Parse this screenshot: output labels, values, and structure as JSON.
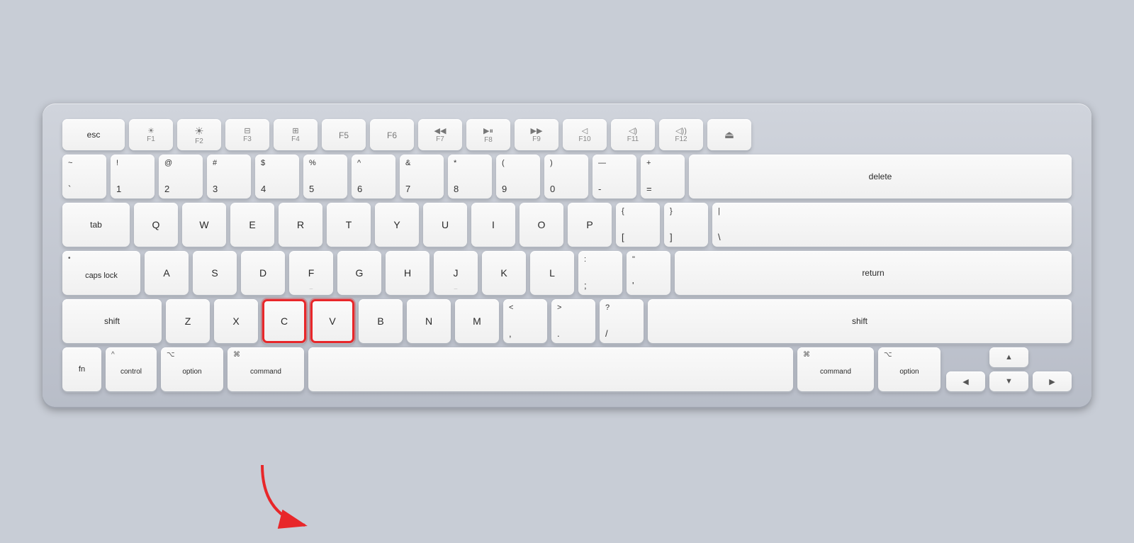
{
  "keyboard": {
    "background_color": "#c0c5d0",
    "rows": {
      "fn_row": {
        "keys": [
          {
            "id": "esc",
            "label": "esc",
            "type": "text"
          },
          {
            "id": "f1",
            "icon": "☀",
            "sub": "F1",
            "type": "icon-fn"
          },
          {
            "id": "f2",
            "icon": "☀",
            "sub": "F2",
            "type": "icon-fn"
          },
          {
            "id": "f3",
            "icon": "⊞",
            "sub": "F3",
            "type": "icon-fn"
          },
          {
            "id": "f4",
            "icon": "⊞⊞",
            "sub": "F4",
            "type": "icon-fn"
          },
          {
            "id": "f5",
            "sub": "F5",
            "type": "fn-only"
          },
          {
            "id": "f6",
            "sub": "F6",
            "type": "fn-only"
          },
          {
            "id": "f7",
            "icon": "⏮",
            "sub": "F7",
            "type": "icon-fn"
          },
          {
            "id": "f8",
            "icon": "⏯",
            "sub": "F8",
            "type": "icon-fn"
          },
          {
            "id": "f9",
            "icon": "⏭",
            "sub": "F9",
            "type": "icon-fn"
          },
          {
            "id": "f10",
            "icon": "🔇",
            "sub": "F10",
            "type": "icon-fn"
          },
          {
            "id": "f11",
            "icon": "🔉",
            "sub": "F11",
            "type": "icon-fn"
          },
          {
            "id": "f12",
            "icon": "🔊",
            "sub": "F12",
            "type": "icon-fn"
          },
          {
            "id": "eject",
            "icon": "⏏",
            "type": "eject"
          }
        ]
      }
    },
    "highlight": {
      "keys": [
        "c",
        "v"
      ],
      "arrow_target": "command"
    }
  }
}
